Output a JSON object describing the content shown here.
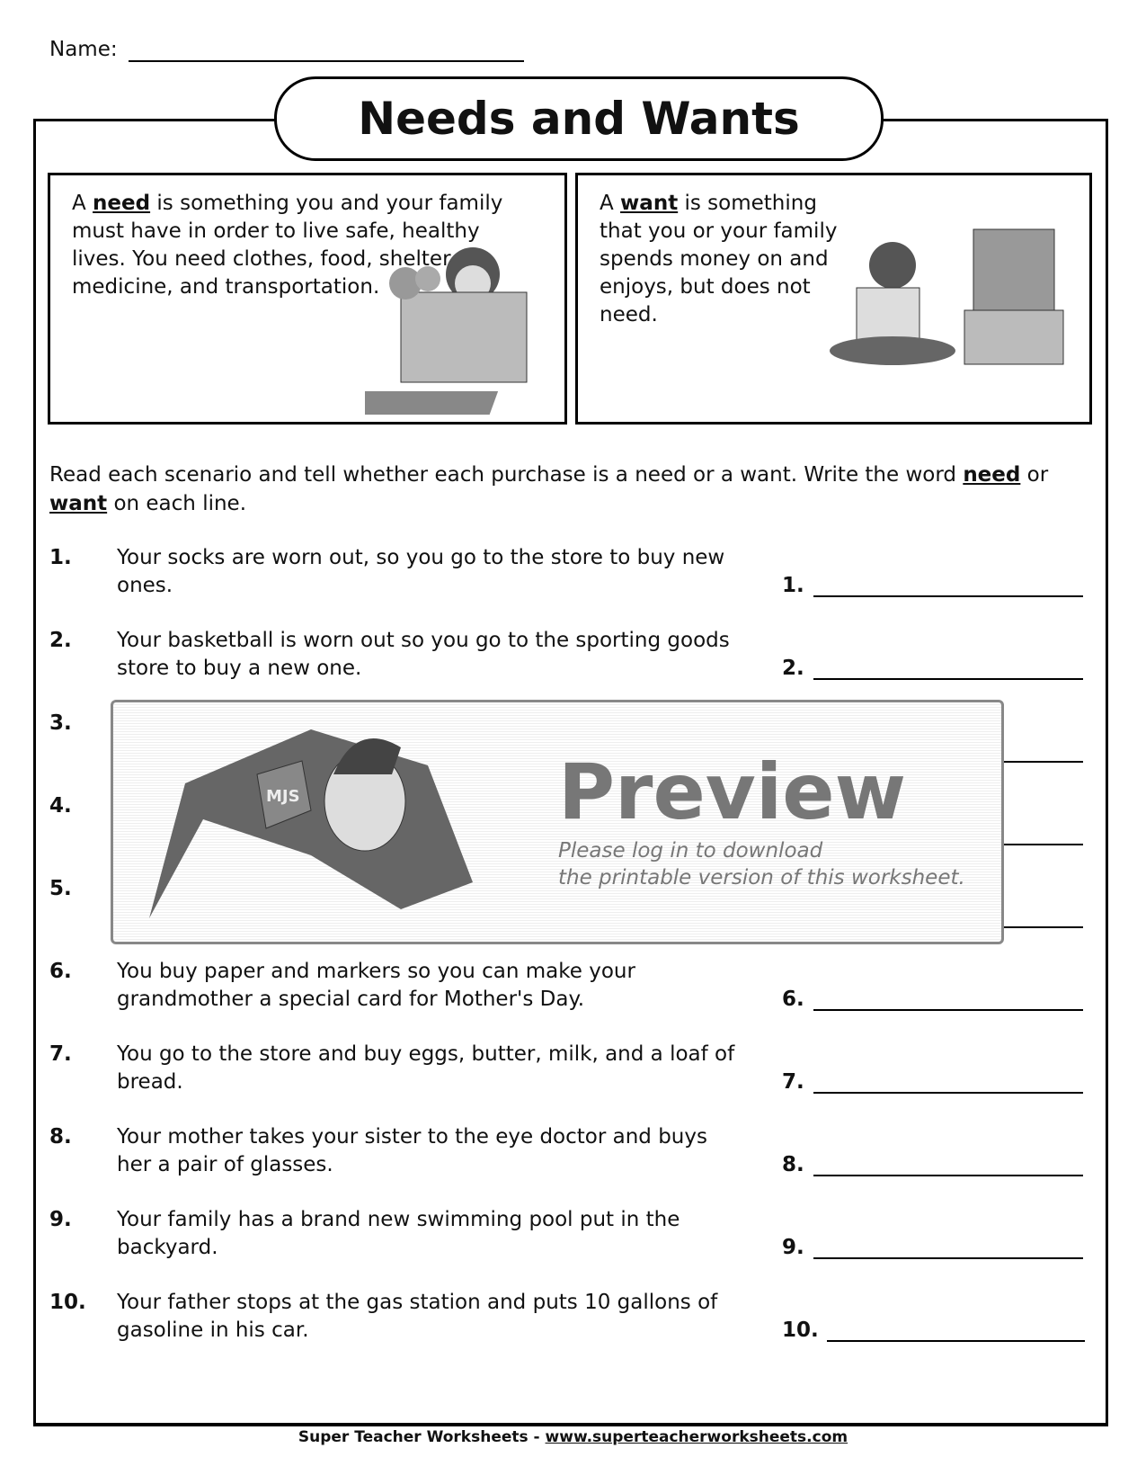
{
  "header": {
    "name_label": "Name:",
    "title": "Needs and Wants"
  },
  "need_box": {
    "prefix": "A ",
    "term": "need",
    "text": " is something you and your family must have in order to live safe, healthy lives.  You need clothes, food, shelter, medicine, and transportation."
  },
  "want_box": {
    "prefix": "A ",
    "term": "want",
    "text": " is something that you or your family spends money on and enjoys, but does not need."
  },
  "instructions": {
    "part1": "Read each scenario and tell whether each purchase is a need or a want.  Write the word ",
    "need": "need",
    "part2": " or ",
    "want": "want",
    "part3": " on each line."
  },
  "questions": [
    {
      "num": "1.",
      "text": "Your socks are worn out, so you go to the store to buy new ones.",
      "answer_label": "1."
    },
    {
      "num": "2.",
      "text": "Your basketball is worn out so you go to the sporting goods store to buy a new one.",
      "answer_label": "2."
    },
    {
      "num": "3.",
      "text": "",
      "answer_label": ""
    },
    {
      "num": "4.",
      "text": "",
      "answer_label": ""
    },
    {
      "num": "5.",
      "text": "",
      "answer_label": ""
    },
    {
      "num": "6.",
      "text": "You buy paper and markers so you can make your grandmother a special card for Mother's Day.",
      "answer_label": "6."
    },
    {
      "num": "7.",
      "text": "You go to the store and buy eggs, butter, milk, and a loaf of bread.",
      "answer_label": "7."
    },
    {
      "num": "8.",
      "text": "Your mother takes your sister to the eye doctor and buys her a pair of glasses.",
      "answer_label": "8."
    },
    {
      "num": "9.",
      "text": "Your family has a brand new swimming pool put in the backyard.",
      "answer_label": "9."
    },
    {
      "num": "10.",
      "text": "Your father stops at the gas station and puts 10 gallons of gasoline in his car.",
      "answer_label": "10."
    }
  ],
  "preview": {
    "title": "Preview",
    "line1": "Please log in to download",
    "line2": "the printable version of this worksheet.",
    "badge": "MJS"
  },
  "footer": {
    "brand": "Super Teacher Worksheets",
    "sep": " - ",
    "url": "www.superteacherworksheets.com"
  }
}
